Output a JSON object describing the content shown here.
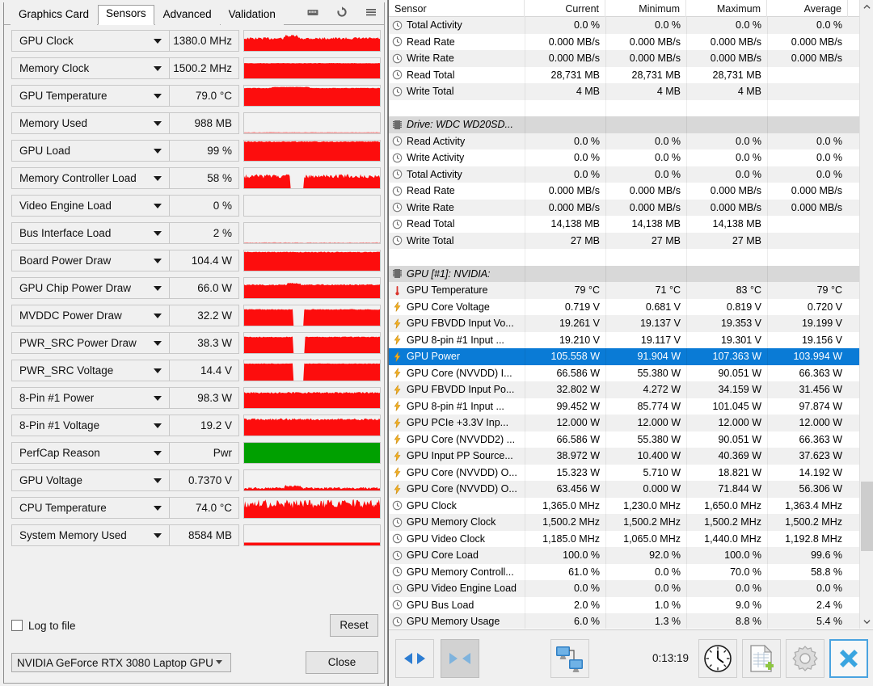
{
  "gpuz": {
    "tabs": [
      {
        "label": "Graphics Card",
        "active": false
      },
      {
        "label": "Sensors",
        "active": true
      },
      {
        "label": "Advanced",
        "active": false
      },
      {
        "label": "Validation",
        "active": false
      }
    ],
    "title_icons": [
      "camera-icon",
      "refresh-icon",
      "menu-icon"
    ],
    "sensors": [
      {
        "name": "GPU Clock",
        "value": "1380.0 MHz",
        "fill": 0.62,
        "color": "#fd0d0d",
        "noise": 0.06,
        "bump": [
          0.3,
          0.4,
          0.12
        ]
      },
      {
        "name": "Memory Clock",
        "value": "1500.2 MHz",
        "fill": 0.75,
        "color": "#fd0d0d",
        "noise": 0.01,
        "bump": null
      },
      {
        "name": "GPU Temperature",
        "value": "79.0 °C",
        "fill": 0.88,
        "color": "#fd0d0d",
        "noise": 0.01,
        "bump": [
          0.2,
          0.48,
          0.05
        ]
      },
      {
        "name": "Memory Used",
        "value": "988 MB",
        "fill": 0.06,
        "color": "#f3a0a0",
        "noise": 0.02,
        "bump": null
      },
      {
        "name": "GPU Load",
        "value": "99 %",
        "fill": 0.95,
        "color": "#fd0d0d",
        "noise": 0.02,
        "bump": null
      },
      {
        "name": "Memory Controller Load",
        "value": "58 %",
        "fill": 0.6,
        "color": "#fd0d0d",
        "noise": 0.1,
        "gap": [
          0.34,
          0.44
        ]
      },
      {
        "name": "Video Engine Load",
        "value": "0 %",
        "fill": 0.0,
        "color": "#f3a0a0",
        "noise": 0.0,
        "bump": null
      },
      {
        "name": "Bus Interface Load",
        "value": "2 %",
        "fill": 0.03,
        "color": "#f08c8c",
        "noise": 0.02,
        "bump": null
      },
      {
        "name": "Board Power Draw",
        "value": "104.4 W",
        "fill": 0.92,
        "color": "#fd0d0d",
        "noise": 0.02,
        "bump": null
      },
      {
        "name": "GPU Chip Power Draw",
        "value": "66.0 W",
        "fill": 0.66,
        "color": "#fd0d0d",
        "noise": 0.03,
        "bump": [
          0.32,
          0.42,
          0.08
        ]
      },
      {
        "name": "MVDDC Power Draw",
        "value": "32.2 W",
        "fill": 0.8,
        "color": "#fd0d0d",
        "noise": 0.02,
        "gap": [
          0.36,
          0.44
        ]
      },
      {
        "name": "PWR_SRC Power Draw",
        "value": "38.3 W",
        "fill": 0.8,
        "color": "#fd0d0d",
        "noise": 0.02,
        "gap": [
          0.36,
          0.45
        ]
      },
      {
        "name": "PWR_SRC Voltage",
        "value": "14.4 V",
        "fill": 0.84,
        "color": "#fd0d0d",
        "noise": 0.01,
        "gap": [
          0.36,
          0.44
        ]
      },
      {
        "name": "8-Pin #1 Power",
        "value": "98.3 W",
        "fill": 0.76,
        "color": "#fd0d0d",
        "noise": 0.04,
        "bump": null
      },
      {
        "name": "8-Pin #1 Voltage",
        "value": "19.2 V",
        "fill": 0.8,
        "color": "#fd0d0d",
        "noise": 0.05,
        "bump": null
      },
      {
        "name": "PerfCap Reason",
        "value": "Pwr",
        "fill": 1.0,
        "color": "#00a000",
        "noise": 0.0,
        "bump": null
      },
      {
        "name": "GPU Voltage",
        "value": "0.7370 V",
        "fill": 0.12,
        "color": "#fd0d0d",
        "noise": 0.05,
        "bump": [
          0.3,
          0.42,
          0.1
        ]
      },
      {
        "name": "CPU Temperature",
        "value": "74.0 °C",
        "fill": 0.7,
        "color": "#fd0d0d",
        "noise": 0.22,
        "bump": null
      },
      {
        "name": "System Memory Used",
        "value": "8584 MB",
        "fill": 0.14,
        "color": "#fd0d0d",
        "noise": 0.0,
        "bump": null
      }
    ],
    "log_to_file_label": "Log to file",
    "log_to_file_checked": false,
    "reset_label": "Reset",
    "device_selected": "NVIDIA GeForce RTX 3080 Laptop GPU",
    "close_label": "Close"
  },
  "hwinfo": {
    "columns": [
      "Sensor",
      "Current",
      "Minimum",
      "Maximum",
      "Average"
    ],
    "rows": [
      {
        "icon": "clock-icon",
        "name": "Total Activity",
        "values": [
          "0.0 %",
          "0.0 %",
          "0.0 %",
          "0.0 %"
        ]
      },
      {
        "icon": "clock-icon",
        "name": "Read Rate",
        "values": [
          "0.000 MB/s",
          "0.000 MB/s",
          "0.000 MB/s",
          "0.000 MB/s"
        ]
      },
      {
        "icon": "clock-icon",
        "name": "Write Rate",
        "values": [
          "0.000 MB/s",
          "0.000 MB/s",
          "0.000 MB/s",
          "0.000 MB/s"
        ]
      },
      {
        "icon": "clock-icon",
        "name": "Read Total",
        "values": [
          "28,731 MB",
          "28,731 MB",
          "28,731 MB",
          ""
        ]
      },
      {
        "icon": "clock-icon",
        "name": "Write Total",
        "values": [
          "4 MB",
          "4 MB",
          "4 MB",
          ""
        ]
      },
      {
        "icon": "",
        "name": "",
        "values": [
          "",
          "",
          "",
          ""
        ],
        "blank": true
      },
      {
        "icon": "chip-icon",
        "name": "Drive: WDC WD20SD...",
        "values": [
          "",
          "",
          "",
          ""
        ],
        "group": true
      },
      {
        "icon": "clock-icon",
        "name": "Read Activity",
        "values": [
          "0.0 %",
          "0.0 %",
          "0.0 %",
          "0.0 %"
        ]
      },
      {
        "icon": "clock-icon",
        "name": "Write Activity",
        "values": [
          "0.0 %",
          "0.0 %",
          "0.0 %",
          "0.0 %"
        ]
      },
      {
        "icon": "clock-icon",
        "name": "Total Activity",
        "values": [
          "0.0 %",
          "0.0 %",
          "0.0 %",
          "0.0 %"
        ]
      },
      {
        "icon": "clock-icon",
        "name": "Read Rate",
        "values": [
          "0.000 MB/s",
          "0.000 MB/s",
          "0.000 MB/s",
          "0.000 MB/s"
        ]
      },
      {
        "icon": "clock-icon",
        "name": "Write Rate",
        "values": [
          "0.000 MB/s",
          "0.000 MB/s",
          "0.000 MB/s",
          "0.000 MB/s"
        ]
      },
      {
        "icon": "clock-icon",
        "name": "Read Total",
        "values": [
          "14,138 MB",
          "14,138 MB",
          "14,138 MB",
          ""
        ]
      },
      {
        "icon": "clock-icon",
        "name": "Write Total",
        "values": [
          "27 MB",
          "27 MB",
          "27 MB",
          ""
        ]
      },
      {
        "icon": "",
        "name": "",
        "values": [
          "",
          "",
          "",
          ""
        ],
        "blank": true
      },
      {
        "icon": "chip-icon",
        "name": "GPU [#1]: NVIDIA:",
        "values": [
          "",
          "",
          "",
          ""
        ],
        "group": true
      },
      {
        "icon": "thermometer-icon",
        "name": "GPU Temperature",
        "values": [
          "79 °C",
          "71 °C",
          "83 °C",
          "79 °C"
        ]
      },
      {
        "icon": "bolt-icon",
        "name": "GPU Core Voltage",
        "values": [
          "0.719 V",
          "0.681 V",
          "0.819 V",
          "0.720 V"
        ]
      },
      {
        "icon": "bolt-icon",
        "name": "GPU FBVDD Input Vo...",
        "values": [
          "19.261 V",
          "19.137 V",
          "19.353 V",
          "19.199 V"
        ]
      },
      {
        "icon": "bolt-icon",
        "name": "GPU 8-pin #1 Input ...",
        "values": [
          "19.210 V",
          "19.117 V",
          "19.301 V",
          "19.156 V"
        ]
      },
      {
        "icon": "bolt-icon",
        "name": "GPU Power",
        "values": [
          "105.558 W",
          "91.904 W",
          "107.363 W",
          "103.994 W"
        ],
        "selected": true
      },
      {
        "icon": "bolt-icon",
        "name": "GPU Core (NVVDD) I...",
        "values": [
          "66.586 W",
          "55.380 W",
          "90.051 W",
          "66.363 W"
        ]
      },
      {
        "icon": "bolt-icon",
        "name": "GPU FBVDD Input Po...",
        "values": [
          "32.802 W",
          "4.272 W",
          "34.159 W",
          "31.456 W"
        ]
      },
      {
        "icon": "bolt-icon",
        "name": "GPU 8-pin #1 Input ...",
        "values": [
          "99.452 W",
          "85.774 W",
          "101.045 W",
          "97.874 W"
        ]
      },
      {
        "icon": "bolt-icon",
        "name": "GPU PCIe +3.3V Inp...",
        "values": [
          "12.000 W",
          "12.000 W",
          "12.000 W",
          "12.000 W"
        ]
      },
      {
        "icon": "bolt-icon",
        "name": "GPU Core (NVVDD2) ...",
        "values": [
          "66.586 W",
          "55.380 W",
          "90.051 W",
          "66.363 W"
        ]
      },
      {
        "icon": "bolt-icon",
        "name": "GPU Input PP Source...",
        "values": [
          "38.972 W",
          "10.400 W",
          "40.369 W",
          "37.623 W"
        ]
      },
      {
        "icon": "bolt-icon",
        "name": "GPU Core (NVVDD) O...",
        "values": [
          "15.323 W",
          "5.710 W",
          "18.821 W",
          "14.192 W"
        ]
      },
      {
        "icon": "bolt-icon",
        "name": "GPU Core (NVVDD) O...",
        "values": [
          "63.456 W",
          "0.000 W",
          "71.844 W",
          "56.306 W"
        ]
      },
      {
        "icon": "clock-icon",
        "name": "GPU Clock",
        "values": [
          "1,365.0 MHz",
          "1,230.0 MHz",
          "1,650.0 MHz",
          "1,363.4 MHz"
        ]
      },
      {
        "icon": "clock-icon",
        "name": "GPU Memory Clock",
        "values": [
          "1,500.2 MHz",
          "1,500.2 MHz",
          "1,500.2 MHz",
          "1,500.2 MHz"
        ]
      },
      {
        "icon": "clock-icon",
        "name": "GPU Video Clock",
        "values": [
          "1,185.0 MHz",
          "1,065.0 MHz",
          "1,440.0 MHz",
          "1,192.8 MHz"
        ]
      },
      {
        "icon": "clock-icon",
        "name": "GPU Core Load",
        "values": [
          "100.0 %",
          "92.0 %",
          "100.0 %",
          "99.6 %"
        ]
      },
      {
        "icon": "clock-icon",
        "name": "GPU Memory Controll...",
        "values": [
          "61.0 %",
          "0.0 %",
          "70.0 %",
          "58.8 %"
        ]
      },
      {
        "icon": "clock-icon",
        "name": "GPU Video Engine Load",
        "values": [
          "0.0 %",
          "0.0 %",
          "0.0 %",
          "0.0 %"
        ]
      },
      {
        "icon": "clock-icon",
        "name": "GPU Bus Load",
        "values": [
          "2.0 %",
          "1.0 %",
          "9.0 %",
          "2.4 %"
        ]
      },
      {
        "icon": "clock-icon",
        "name": "GPU Memory Usage",
        "values": [
          "6.0 %",
          "1.3 %",
          "8.8 %",
          "5.4 %"
        ]
      }
    ],
    "toolbar": {
      "buttons": [
        {
          "name": "expand-all-button",
          "icon": "arrows-out-icon",
          "pressed": false
        },
        {
          "name": "collapse-all-button",
          "icon": "arrows-in-icon",
          "pressed": true
        },
        {
          "name": "remote-monitor-button",
          "icon": "two-monitors-icon",
          "pressed": false
        },
        {
          "name": "timer-button",
          "icon": "clock-face-icon",
          "pressed": false
        },
        {
          "name": "logging-button",
          "icon": "new-log-file-icon",
          "pressed": false
        },
        {
          "name": "settings-button",
          "icon": "gear-icon",
          "pressed": false
        },
        {
          "name": "close-button",
          "icon": "blue-x-icon",
          "pressed": false,
          "accent": true
        }
      ],
      "timer": "0:13:19"
    },
    "colors": {
      "selection": "#0a7bd6",
      "group_header": "#d8d8d8",
      "alt_row": "#f0f0f0"
    }
  }
}
